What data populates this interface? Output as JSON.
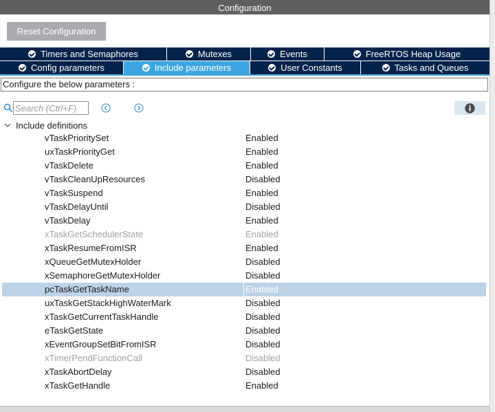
{
  "window": {
    "title": "Configuration"
  },
  "toolbar": {
    "reset_label": "Reset Configuration"
  },
  "tabs_row1": [
    {
      "label": "Timers and Semaphores"
    },
    {
      "label": "Mutexes"
    },
    {
      "label": "Events"
    },
    {
      "label": "FreeRTOS Heap Usage"
    }
  ],
  "tabs_row2": [
    {
      "label": "Config parameters"
    },
    {
      "label": "Include parameters",
      "active": true
    },
    {
      "label": "User Constants"
    },
    {
      "label": "Tasks and Queues"
    }
  ],
  "configure_text": "Configure the below parameters :",
  "search": {
    "placeholder": "Search (Ctrl+F)"
  },
  "group": {
    "label": "Include definitions",
    "expanded": true
  },
  "params": [
    {
      "name": "vTaskPrioritySet",
      "value": "Enabled"
    },
    {
      "name": "uxTaskPriorityGet",
      "value": "Enabled"
    },
    {
      "name": "vTaskDelete",
      "value": "Enabled"
    },
    {
      "name": "vTaskCleanUpResources",
      "value": "Disabled"
    },
    {
      "name": "vTaskSuspend",
      "value": "Enabled"
    },
    {
      "name": "vTaskDelayUntil",
      "value": "Disabled"
    },
    {
      "name": "vTaskDelay",
      "value": "Enabled"
    },
    {
      "name": "xTaskGetSchedulerState",
      "value": "Enabled",
      "greyed": true
    },
    {
      "name": "xTaskResumeFromISR",
      "value": "Enabled"
    },
    {
      "name": "xQueueGetMutexHolder",
      "value": "Disabled"
    },
    {
      "name": "xSemaphoreGetMutexHolder",
      "value": "Disabled"
    },
    {
      "name": "pcTaskGetTaskName",
      "value": "Enabled",
      "selected": true
    },
    {
      "name": "uxTaskGetStackHighWaterMark",
      "value": "Disabled"
    },
    {
      "name": "xTaskGetCurrentTaskHandle",
      "value": "Disabled"
    },
    {
      "name": "eTaskGetState",
      "value": "Disabled"
    },
    {
      "name": "xEventGroupSetBitFromISR",
      "value": "Disabled"
    },
    {
      "name": "xTimerPendFunctionCall",
      "value": "Disabled",
      "greyed": true
    },
    {
      "name": "xTaskAbortDelay",
      "value": "Disabled"
    },
    {
      "name": "xTaskGetHandle",
      "value": "Enabled"
    }
  ],
  "colors": {
    "tab_bg": "#03234b",
    "tab_active": "#3ca6e0",
    "selected_row": "#bcd2e6",
    "greyed_text": "#a0a0a0"
  }
}
